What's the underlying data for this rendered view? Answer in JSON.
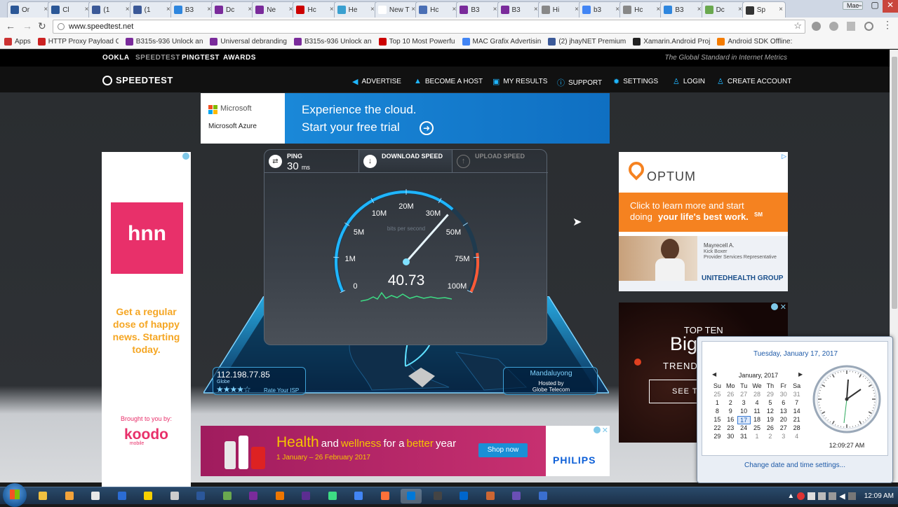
{
  "browser": {
    "tabs": [
      {
        "title": "Or",
        "color": "#2b5797"
      },
      {
        "title": "Cl",
        "color": "#2b5797"
      },
      {
        "title": "(1",
        "color": "#3b5998"
      },
      {
        "title": "(1",
        "color": "#3b5998"
      },
      {
        "title": "B3",
        "color": "#2e86de"
      },
      {
        "title": "Dc",
        "color": "#7a2b9b"
      },
      {
        "title": "Ne",
        "color": "#7a2b9b"
      },
      {
        "title": "Hc",
        "color": "#cc0000"
      },
      {
        "title": "He",
        "color": "#3aa0d0"
      },
      {
        "title": "New T",
        "color": "#ffffff"
      },
      {
        "title": "Hc",
        "color": "#4a6fb5"
      },
      {
        "title": "B3",
        "color": "#7a2b9b"
      },
      {
        "title": "B3",
        "color": "#7a2b9b"
      },
      {
        "title": "Hi",
        "color": "#888888"
      },
      {
        "title": "b3",
        "color": "#4285f4"
      },
      {
        "title": "Hc",
        "color": "#888888"
      },
      {
        "title": "B3",
        "color": "#2e86de"
      },
      {
        "title": "Dc",
        "color": "#6aa84f"
      },
      {
        "title": "Sp",
        "color": "#333333"
      }
    ],
    "window_label": "Mac",
    "url": "www.speedtest.net",
    "bookmarks": [
      {
        "label": "Apps",
        "color": "#c33"
      },
      {
        "label": "HTTP Proxy Payload C",
        "color": "#c22"
      },
      {
        "label": "B315s-936 Unlock an",
        "color": "#7a2b9b"
      },
      {
        "label": "Universal debranding",
        "color": "#7a2b9b"
      },
      {
        "label": "B315s-936 Unlock an",
        "color": "#7a2b9b"
      },
      {
        "label": "Top 10 Most Powerfu",
        "color": "#cc0000"
      },
      {
        "label": "MAC Grafix Advertisin",
        "color": "#4285f4"
      },
      {
        "label": "(2) jhayNET Premium",
        "color": "#3b5998"
      },
      {
        "label": "Xamarin.Android Proj",
        "color": "#222"
      },
      {
        "label": "Android SDK Offline:",
        "color": "#f57c00"
      }
    ]
  },
  "site": {
    "topnav": [
      "OOKLA",
      "SPEEDTEST",
      "PINGTEST",
      "AWARDS"
    ],
    "tagline": "The Global Standard in Internet Metrics",
    "logo": "SPEEDTEST",
    "nav": [
      "ADVERTISE",
      "BECOME A HOST",
      "MY RESULTS",
      "SUPPORT",
      "SETTINGS",
      "LOGIN",
      "CREATE ACCOUNT"
    ]
  },
  "ads": {
    "top": {
      "brand": "Microsoft",
      "sub": "Microsoft Azure",
      "line1": "Experience the cloud.",
      "line2": "Start your free trial"
    },
    "left": {
      "logo": "hnn",
      "text": "Get a regular dose of happy news. Starting today.",
      "brought": "Brought to you by:",
      "brand": "koodo",
      "brand_sub": "mobile"
    },
    "right1": {
      "brand": "OPTUM",
      "text1": "Click to learn more and start",
      "text2": "doing",
      "text3": "your life's best work.",
      "sm": "SM",
      "person_name": "Mayrecell A.",
      "person_role1": "Kick Boxer",
      "person_role2": "Provider Services Representative",
      "group": "UNITEDHEALTH GROUP"
    },
    "right2": {
      "line1": "TOP TEN",
      "line2": "Big",
      "line3": "TRENDS",
      "cta": "SEE TH"
    },
    "bottom": {
      "w1": "Health",
      "w2": "and",
      "w3": "wellness",
      "w4": "for a",
      "w5": "better",
      "w6": "year",
      "dates": "1 January – 26 February 2017",
      "btn": "Shop now",
      "brand": "PHILIPS"
    }
  },
  "speedtest": {
    "ping_label": "PING",
    "ping_value": "30",
    "ping_unit": "ms",
    "download_label": "DOWNLOAD SPEED",
    "upload_label": "UPLOAD SPEED",
    "scale": [
      "0",
      "1M",
      "5M",
      "10M",
      "20M",
      "30M",
      "50M",
      "75M",
      "100M"
    ],
    "unit_caption": "bits per second",
    "current": "40.73",
    "needle_fraction": 0.68,
    "ip": "112.198.77.85",
    "isp": "Globe",
    "rate_isp": "Rate Your ISP",
    "stars": 4,
    "server_city": "Mandaluyong",
    "hosted_by": "Hosted by",
    "host": "Globe Telecom"
  },
  "calendar": {
    "long_date": "Tuesday, January 17, 2017",
    "month": "January, 2017",
    "dow": [
      "Su",
      "Mo",
      "Tu",
      "We",
      "Th",
      "Fr",
      "Sa"
    ],
    "weeks": [
      [
        "25",
        "26",
        "27",
        "28",
        "29",
        "30",
        "31"
      ],
      [
        "1",
        "2",
        "3",
        "4",
        "5",
        "6",
        "7"
      ],
      [
        "8",
        "9",
        "10",
        "11",
        "12",
        "13",
        "14"
      ],
      [
        "15",
        "16",
        "17",
        "18",
        "19",
        "20",
        "21"
      ],
      [
        "22",
        "23",
        "24",
        "25",
        "26",
        "27",
        "28"
      ],
      [
        "29",
        "30",
        "31",
        "1",
        "2",
        "3",
        "4"
      ]
    ],
    "time": "12:09:27 AM",
    "settings_link": "Change date and time settings..."
  },
  "taskbar": {
    "clock": "12:09 AM",
    "apps": [
      "#f0c040",
      "#f3a33a",
      "#e8e8e8",
      "#2b6cd4",
      "#f8d000",
      "#cccccc",
      "#2b579a",
      "#6aa84f",
      "#7a2b9b",
      "#ee7600",
      "#5c2d91",
      "#3ddc84",
      "#4285f4",
      "#ff7139",
      "#0078d7",
      "#444444",
      "#0066cc",
      "#cc6633",
      "#6a4fb5",
      "#3a6fcf"
    ]
  }
}
